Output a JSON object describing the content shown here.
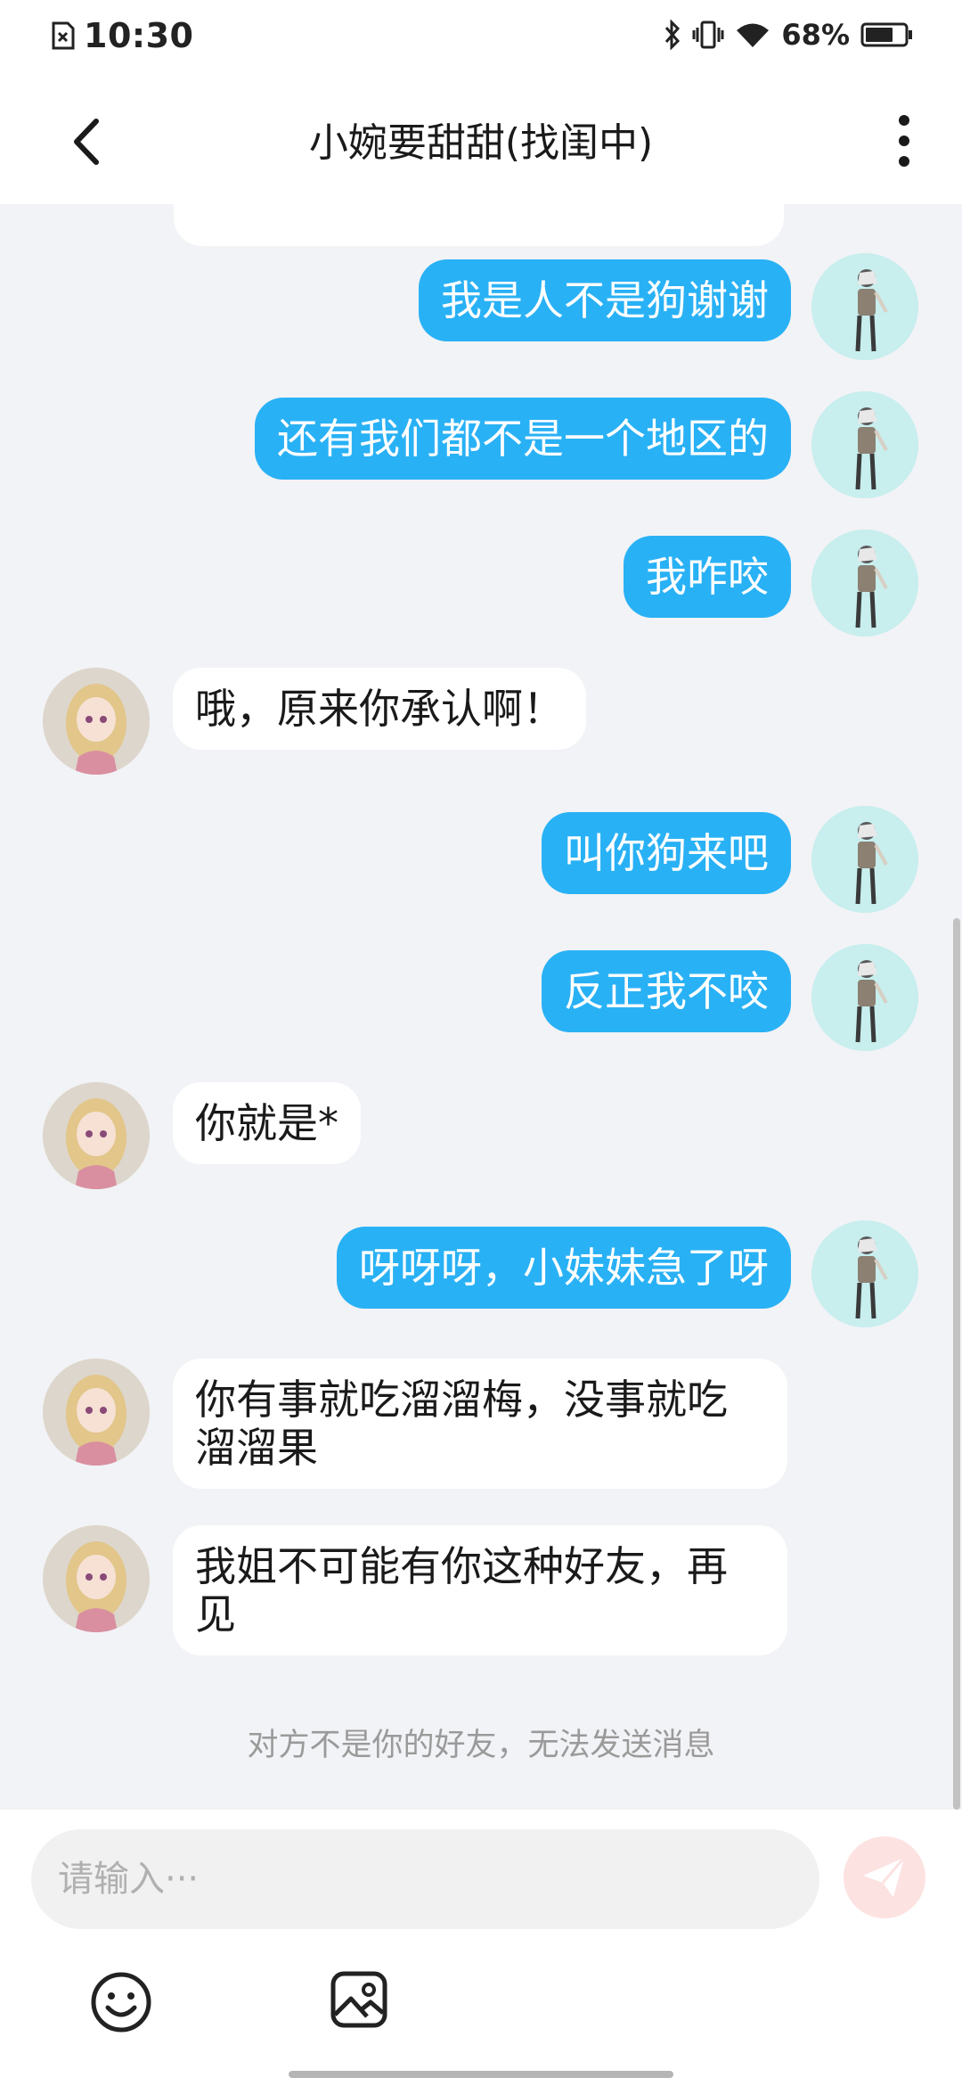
{
  "status_bar": {
    "time": "10:30",
    "battery": "68%"
  },
  "header": {
    "title": "小婉要甜甜(找闺中)"
  },
  "messages": [
    {
      "from": "me",
      "text": "我是人不是狗谢谢"
    },
    {
      "from": "me",
      "text": "还有我们都不是一个地区的"
    },
    {
      "from": "me",
      "text": "我咋咬"
    },
    {
      "from": "other",
      "text": "哦，原来你承认啊！"
    },
    {
      "from": "me",
      "text": "叫你狗来吧"
    },
    {
      "from": "me",
      "text": "反正我不咬"
    },
    {
      "from": "other",
      "text": "你就是*"
    },
    {
      "from": "me",
      "text": "呀呀呀，小妹妹急了呀"
    },
    {
      "from": "other",
      "text": "你有事就吃溜溜梅，没事就吃溜溜果"
    },
    {
      "from": "other",
      "text": "我姐不可能有你这种好友，再见"
    }
  ],
  "notice": "对方不是你的好友，无法发送消息",
  "input": {
    "placeholder": "请输入···"
  },
  "colors": {
    "my_bubble": "#29b1f5",
    "other_bubble": "#ffffff",
    "background": "#f2f3f6"
  }
}
